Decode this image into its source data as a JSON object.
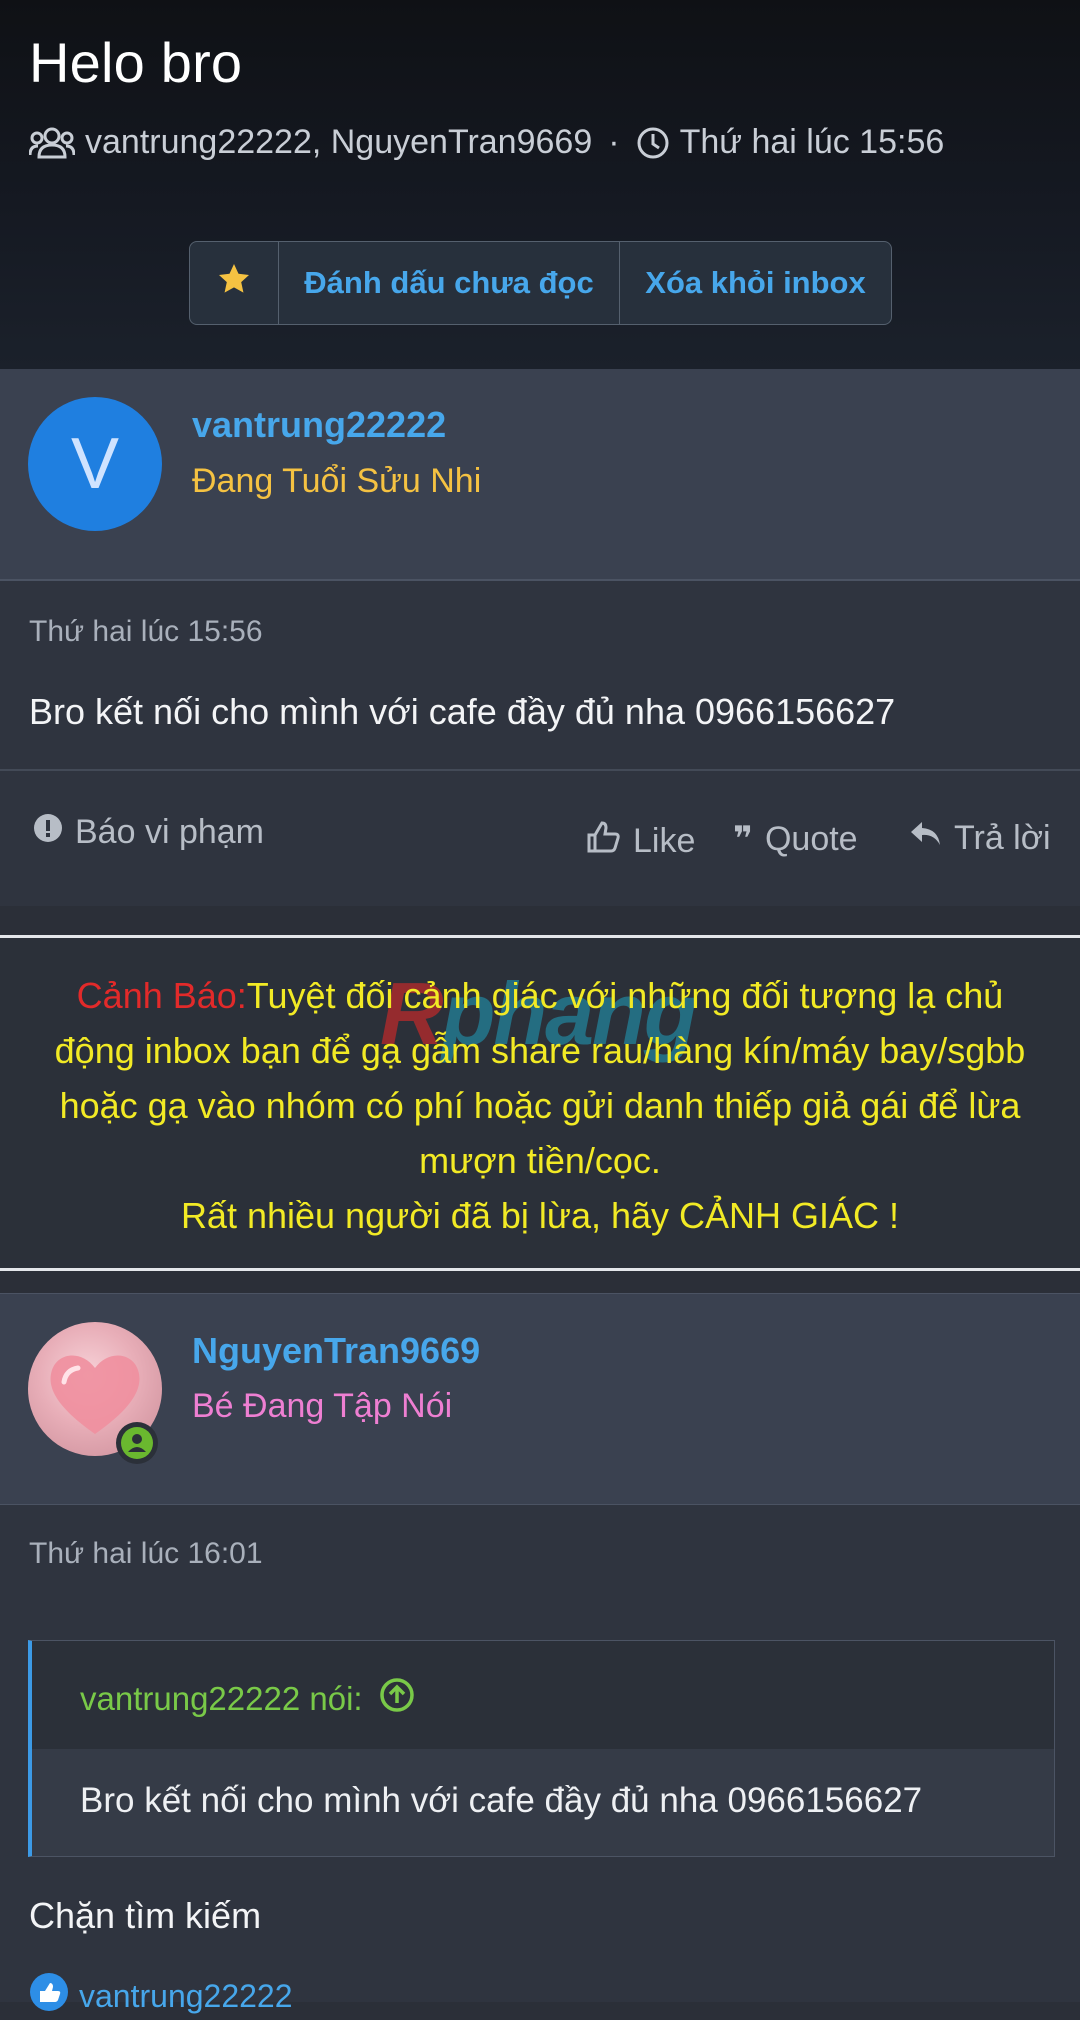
{
  "conversation": {
    "title": "Helo bro",
    "participants": "vantrung22222, NguyenTran9669",
    "separator": "·",
    "started": "Thứ hai lúc 15:56"
  },
  "toolbar": {
    "star_icon": "star-icon",
    "mark_unread": "Đánh dấu chưa đọc",
    "remove_inbox": "Xóa khỏi inbox"
  },
  "posts": [
    {
      "avatar_letter": "V",
      "username": "vantrung22222",
      "user_title": "Đang Tuổi Sửu Nhi",
      "date": "Thứ hai lúc 15:56",
      "message": "Bro kết nối cho mình với cafe đầy đủ nha 0966156627",
      "report": "Báo vi phạm",
      "like": "Like",
      "quote": "Quote",
      "reply": "Trả lời"
    },
    {
      "username": "NguyenTran9669",
      "user_title": "Bé Đang Tập Nói",
      "date": "Thứ hai lúc 16:01",
      "quote_author": "vantrung22222 nói:",
      "quote_text": "Bro kết nối cho mình với cafe đầy đủ nha 0966156627",
      "message": "Chặn tìm kiếm",
      "liked_by": "vantrung22222"
    }
  ],
  "warning": {
    "logo_text_r": "R",
    "logo_text_rest": "phang",
    "label": "Cảnh Báo:",
    "line1": "Tuyệt đối cảnh giác với những đối tượng lạ chủ",
    "line2": "động inbox bạn để gạ gẫm share rau/hàng kín/máy bay/sgbb",
    "line3": "hoặc gạ vào nhóm có phí hoặc gửi danh thiếp giả gái để lừa",
    "line4": "mượn tiền/cọc.",
    "line5": "Rất nhiều người đã bị lừa, hãy CẢNH GIÁC !"
  },
  "colors": {
    "link_blue": "#47a7eb",
    "warning_yellow": "#f2ea25",
    "warning_red": "#e22a2a",
    "quote_green": "#79c948",
    "online_green": "#6ab82f"
  }
}
